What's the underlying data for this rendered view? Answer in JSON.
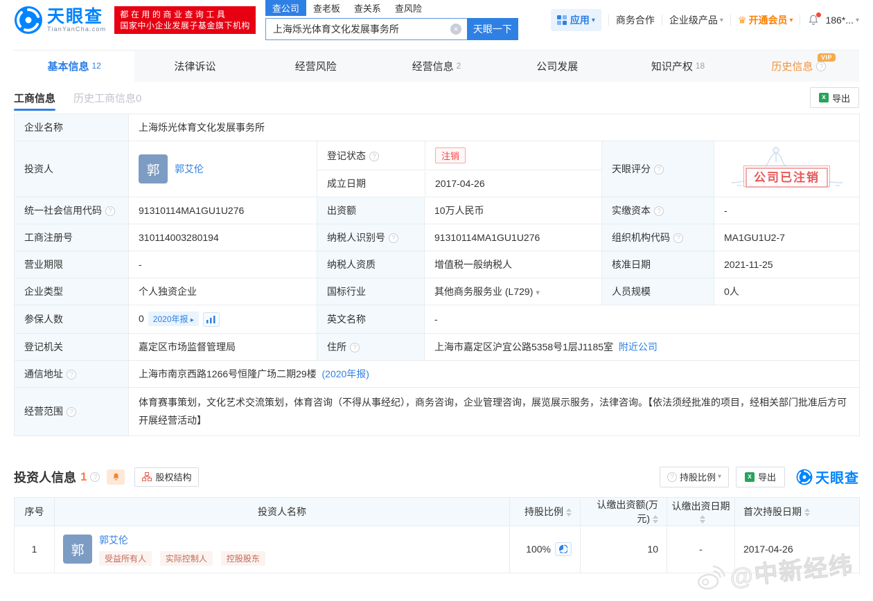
{
  "colors": {
    "brand_blue": "#0084ff",
    "link_blue": "#2f80e4",
    "promo_red": "#e60012",
    "vip_orange": "#f5ab4c",
    "member_orange": "#ff7e00",
    "status_red": "#f04646",
    "label_bg": "#f3f9fc"
  },
  "icons": {
    "logo": "aperture-swirl-circle",
    "apps": "grid-4-squares",
    "crown": "♛",
    "bell": "bell-shape",
    "caret_down": "▾",
    "arrow_right": "▸",
    "excel": "green-spreadsheet",
    "pie": "pie-slice",
    "trend": "bar-chart",
    "help": "?",
    "clear": "×",
    "org_chart": "equity-structure-tree",
    "weibo": "weibo-eye"
  },
  "header": {
    "logo_text": "天眼查",
    "logo_sub": "TianYanCha.com",
    "promo_line1": "都在用的商业查询工具",
    "promo_line2": "国家中小企业发展子基金旗下机构",
    "search_tabs": [
      "查公司",
      "查老板",
      "查关系",
      "查风险"
    ],
    "search_value": "上海烁光体育文化发展事务所",
    "search_button": "天眼一下",
    "nav_apps": "应用",
    "nav_business": "商务合作",
    "nav_enterprise": "企业级产品",
    "nav_vip": "开通会员",
    "nav_account": "186*..."
  },
  "tabs": [
    {
      "label": "基本信息",
      "count": "12"
    },
    {
      "label": "法律诉讼",
      "count": ""
    },
    {
      "label": "经营风险",
      "count": ""
    },
    {
      "label": "经营信息",
      "count": "2"
    },
    {
      "label": "公司发展",
      "count": ""
    },
    {
      "label": "知识产权",
      "count": "18"
    },
    {
      "label": "历史信息",
      "count": "",
      "vip": "VIP"
    }
  ],
  "subtabs": {
    "active": "工商信息",
    "history": "历史工商信息0",
    "export_label": "导出"
  },
  "info": {
    "company_name_label": "企业名称",
    "company_name": "上海烁光体育文化发展事务所",
    "investor_label": "投资人",
    "investor_avatar": "郭",
    "investor_name": "郭艾伦",
    "reg_status_label": "登记状态",
    "reg_status": "注销",
    "establish_date_label": "成立日期",
    "establish_date": "2017-04-26",
    "score_label": "天眼评分",
    "stamp": "公司已注销",
    "credit_code_label": "统一社会信用代码",
    "credit_code": "91310114MA1GU1U276",
    "capital_label": "出资额",
    "capital": "10万人民币",
    "paid_capital_label": "实缴资本",
    "paid_capital": "-",
    "reg_number_label": "工商注册号",
    "reg_number": "310114003280194",
    "taxpayer_id_label": "纳税人识别号",
    "taxpayer_id": "91310114MA1GU1U276",
    "org_code_label": "组织机构代码",
    "org_code": "MA1GU1U2-7",
    "term_label": "营业期限",
    "term": "-",
    "taxpayer_quality_label": "纳税人资质",
    "taxpayer_quality": "增值税一般纳税人",
    "approval_date_label": "核准日期",
    "approval_date": "2021-11-25",
    "company_type_label": "企业类型",
    "company_type": "个人独资企业",
    "industry_label": "国标行业",
    "industry": "其他商务服务业 (L729)",
    "staff_label": "人员规模",
    "staff": "0人",
    "insured_label": "参保人数",
    "insured": "0",
    "insured_badge": "2020年报",
    "english_label": "英文名称",
    "english_name": "-",
    "authority_label": "登记机关",
    "authority": "嘉定区市场监督管理局",
    "address_label": "住所",
    "address": "上海市嘉定区沪宜公路5358号1层J1185室",
    "address_link": "附近公司",
    "mail_label": "通信地址",
    "mail_address": "上海市南京西路1266号恒隆广场二期29楼",
    "mail_note": "(2020年报)",
    "scope_label": "经营范围",
    "scope": "体育赛事策划，文化艺术交流策划，体育咨询（不得从事经纪），商务咨询，企业管理咨询，展览展示服务，法律咨询。【依法须经批准的项目，经相关部门批准后方可开展经营活动】"
  },
  "investors": {
    "title": "投资人信息",
    "count": "1",
    "equity_structure": "股权结构",
    "ratio_button": "持股比例",
    "export_label": "导出",
    "brand": "天眼查",
    "headers": {
      "index": "序号",
      "name": "投资人名称",
      "ratio": "持股比例",
      "amount": "认缴出资额(万元)",
      "date": "认缴出资日期",
      "first_date": "首次持股日期"
    },
    "rows": [
      {
        "index": "1",
        "avatar": "郭",
        "name": "郭艾伦",
        "tags": [
          "受益所有人",
          "实际控制人",
          "控股股东"
        ],
        "ratio": "100%",
        "amount": "10",
        "date": "-",
        "first_date": "2017-04-26"
      }
    ]
  },
  "watermark": "@中新经纬"
}
